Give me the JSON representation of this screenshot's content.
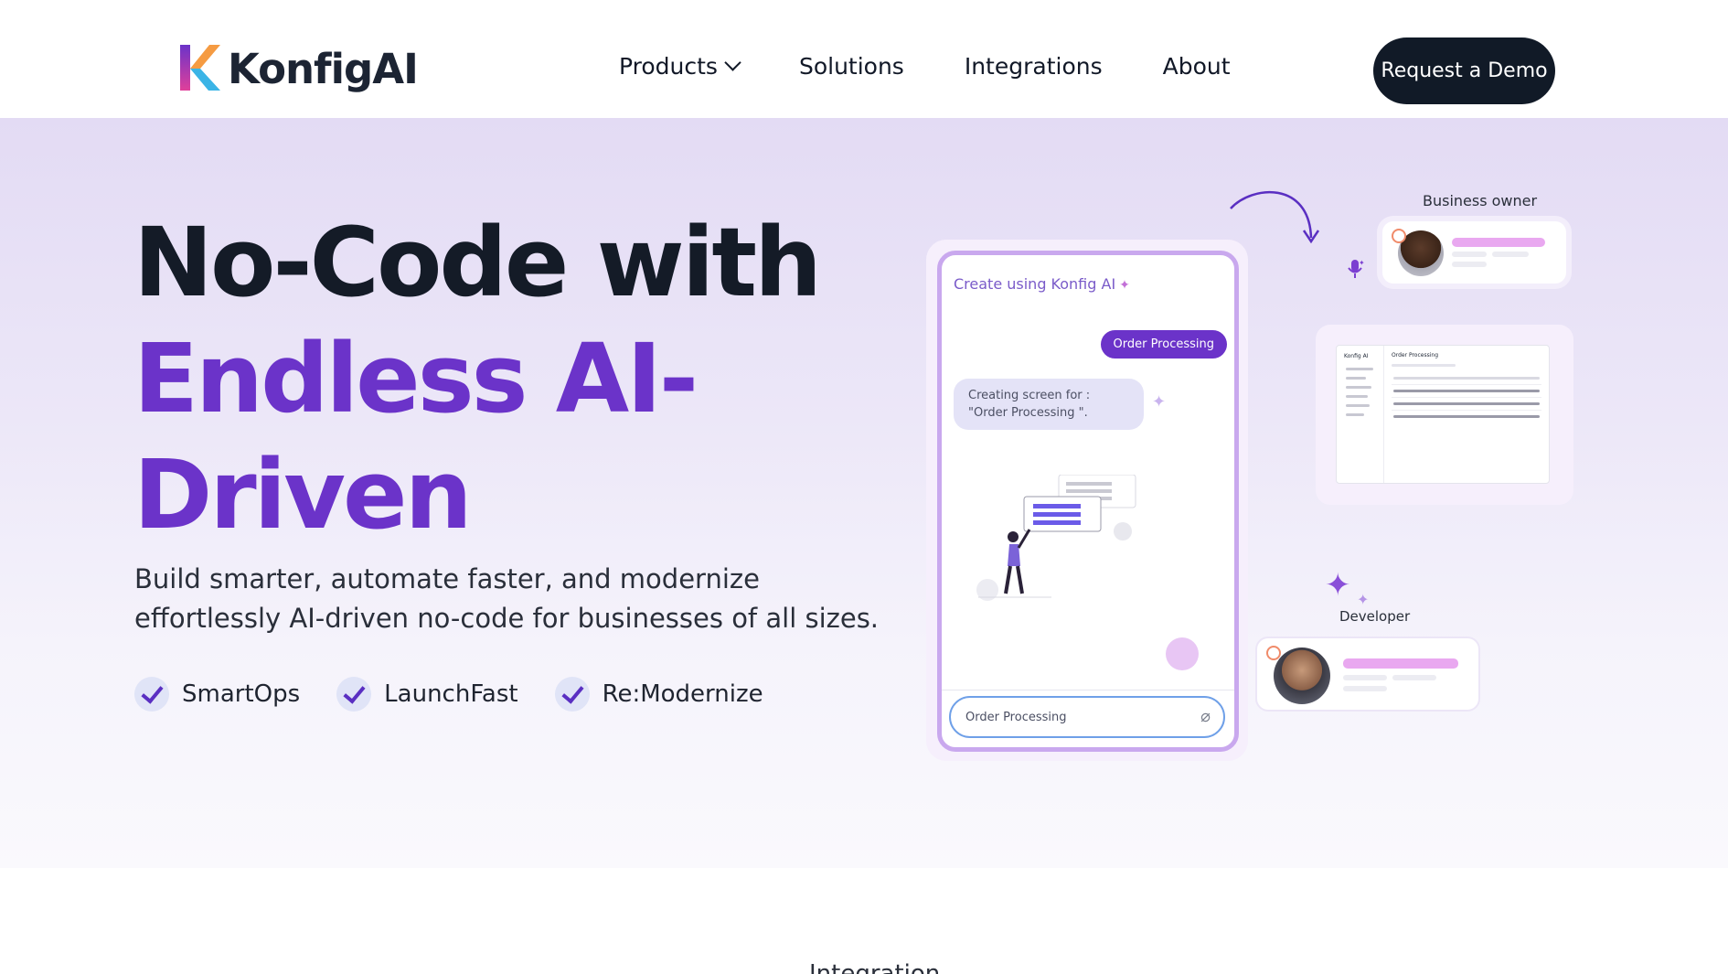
{
  "header": {
    "brand": "KonfigAI",
    "nav": [
      {
        "label": "Products",
        "has_dropdown": true
      },
      {
        "label": "Solutions"
      },
      {
        "label": "Integrations"
      },
      {
        "label": "About"
      }
    ],
    "cta_label": "Request a Demo"
  },
  "hero": {
    "headline_line1": "No-Code with",
    "headline_line2": "Endless AI-",
    "headline_line3": "Driven",
    "subtitle": "Build smarter, automate faster, and modernize effortlessly AI-driven no-code for businesses of all sizes.",
    "features": [
      "SmartOps",
      "LaunchFast",
      "Re:Modernize"
    ]
  },
  "phone": {
    "title": "Create using Konfig AI",
    "user_message": "Order Processing",
    "bot_message": "Creating screen for : \"Order Processing \".",
    "input_value": "Order Processing"
  },
  "cards": {
    "owner_label": "Business owner",
    "developer_label": "Developer",
    "dashboard_brand": "Konfig AI",
    "dashboard_title": "Order Processing"
  },
  "next_section": {
    "label": "Integration"
  },
  "colors": {
    "accent_purple": "#6b33c9",
    "dark_navy": "#111a27",
    "pink_bar": "#e9a8f0",
    "input_blue": "#6fa0e8"
  }
}
